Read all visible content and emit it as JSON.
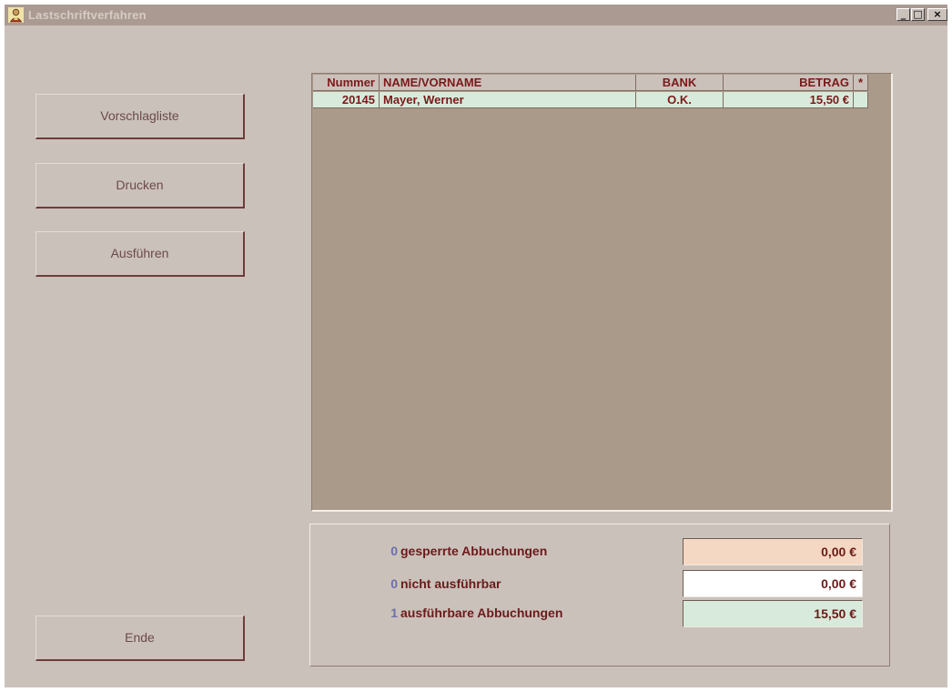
{
  "window": {
    "title": "Lastschriftverfahren",
    "controls": {
      "minimize": "_",
      "maximize": "□",
      "close": "×"
    }
  },
  "buttons": {
    "vorschlagliste": "Vorschlagliste",
    "drucken": "Drucken",
    "ausfuehren": "Ausführen",
    "ende": "Ende"
  },
  "grid": {
    "columns": {
      "nummer": "Nummer",
      "name": "NAME/VORNAME",
      "bank": "BANK",
      "betrag": "BETRAG",
      "mark": "*"
    },
    "rows": [
      {
        "nummer": "20145",
        "name": "Mayer, Werner",
        "bank": "O.K.",
        "betrag": "15,50 €",
        "mark": ""
      }
    ]
  },
  "summary": {
    "gesperrt": {
      "count": "0",
      "label": "gesperrte Abbuchungen",
      "amount": "0,00 €"
    },
    "nicht_ausfuehrbar": {
      "count": "0",
      "label": "nicht ausführbar",
      "amount": "0,00 €"
    },
    "ausfuehrbar": {
      "count": "1",
      "label": "ausführbare Abbuchungen",
      "amount": "15,50 €"
    }
  },
  "colors": {
    "window_bg": "#cbc1bb",
    "grid_bg": "#aa9a8a",
    "row_highlight": "#d8eadb",
    "blocked_bg": "#f5d8c4",
    "ok_bg": "#d8eadb",
    "text_dark_red": "#7a1a1a",
    "count_blue": "#6b6fa8"
  },
  "icons": {
    "app": "app-person-icon"
  }
}
